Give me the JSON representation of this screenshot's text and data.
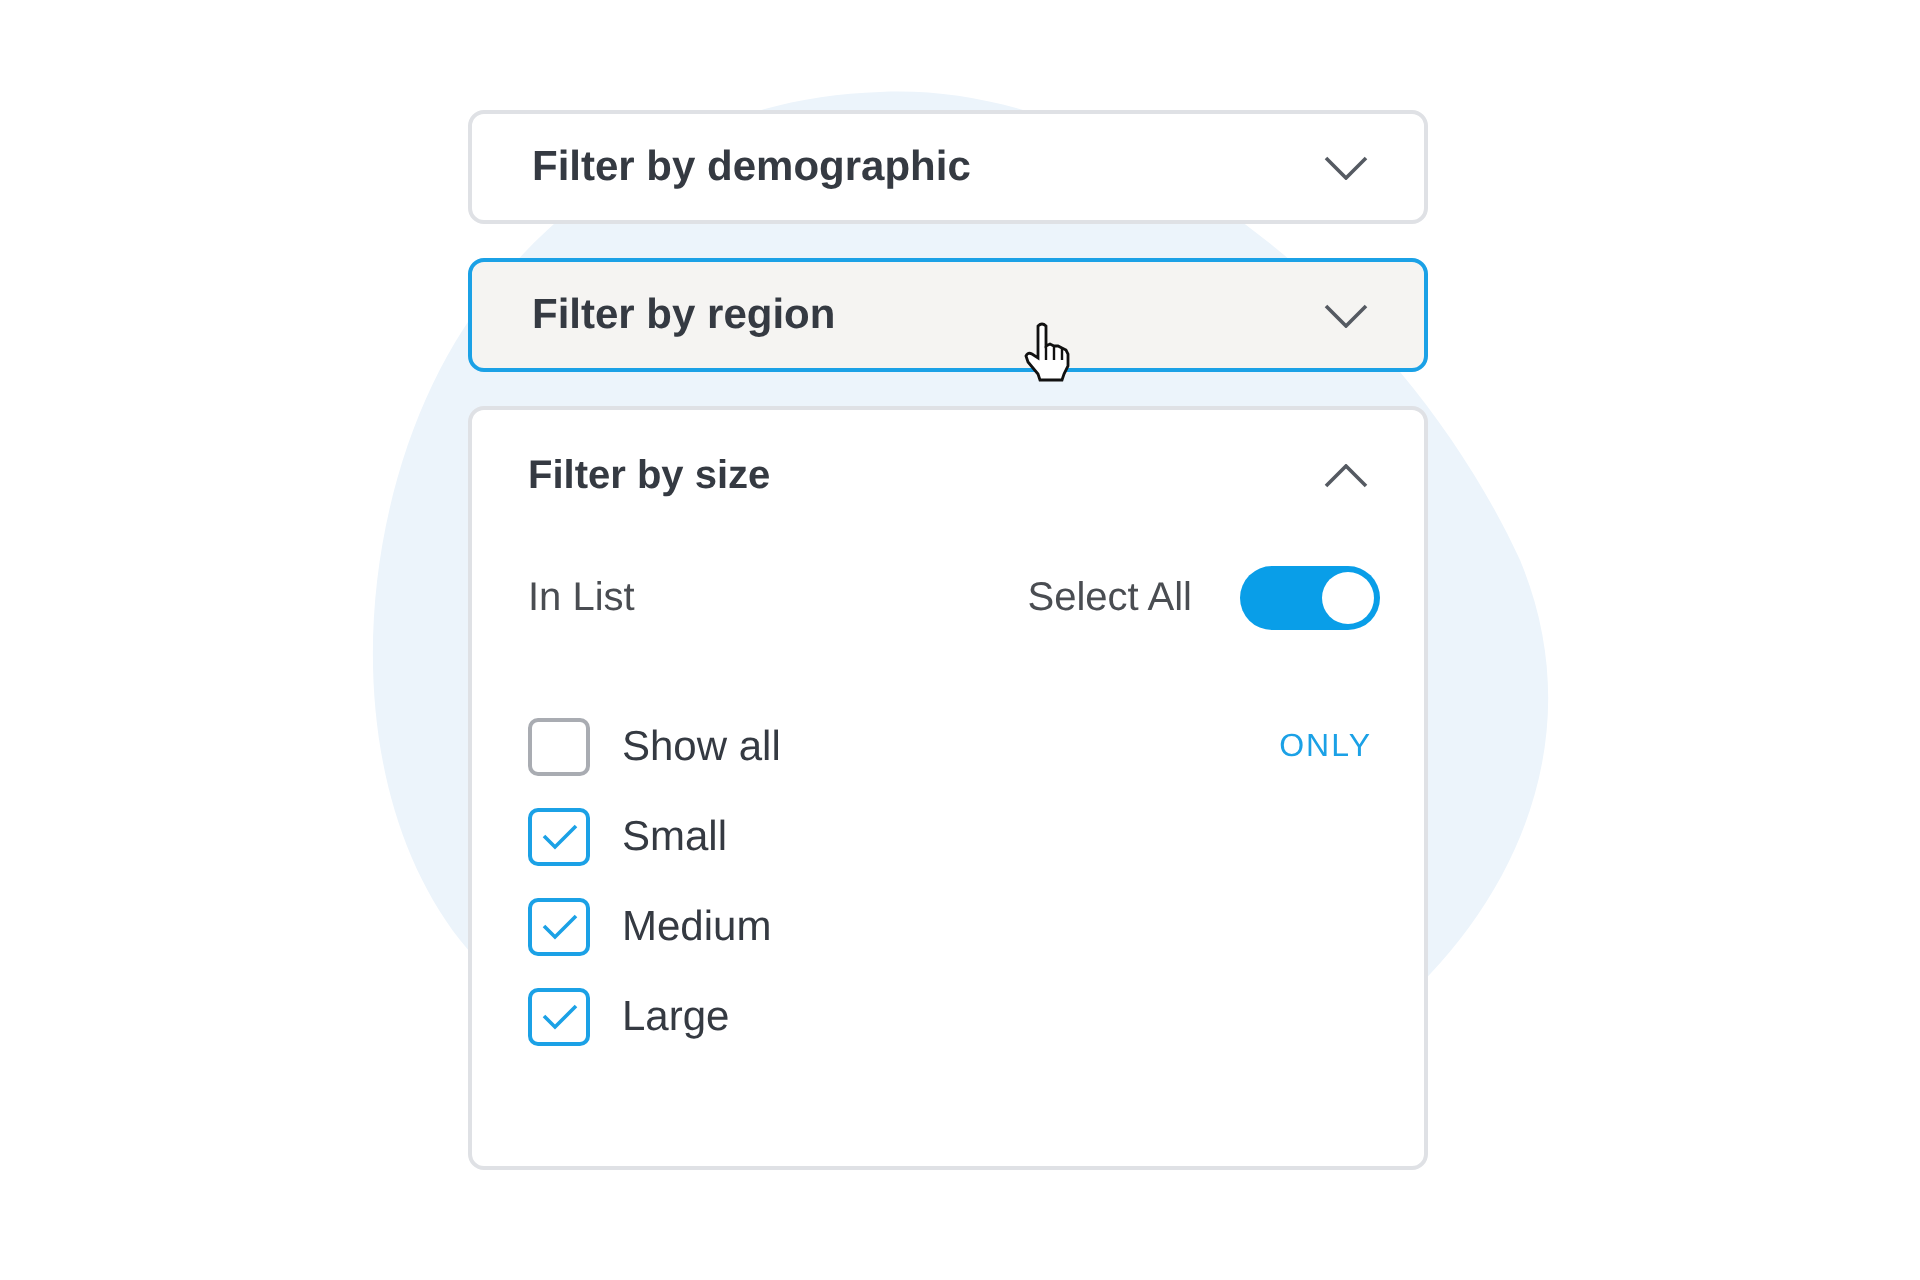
{
  "filters": [
    {
      "label": "Filter by demographic",
      "expanded": false,
      "hovered": false
    },
    {
      "label": "Filter by region",
      "expanded": false,
      "hovered": true
    },
    {
      "label": "Filter by size",
      "expanded": true,
      "hovered": false,
      "list_label": "In List",
      "select_all": {
        "label": "Select All",
        "on": true
      },
      "options": [
        {
          "label": "Show all",
          "checked": false,
          "action": "ONLY"
        },
        {
          "label": "Small",
          "checked": true
        },
        {
          "label": "Medium",
          "checked": true
        },
        {
          "label": "Large",
          "checked": true
        }
      ]
    }
  ]
}
